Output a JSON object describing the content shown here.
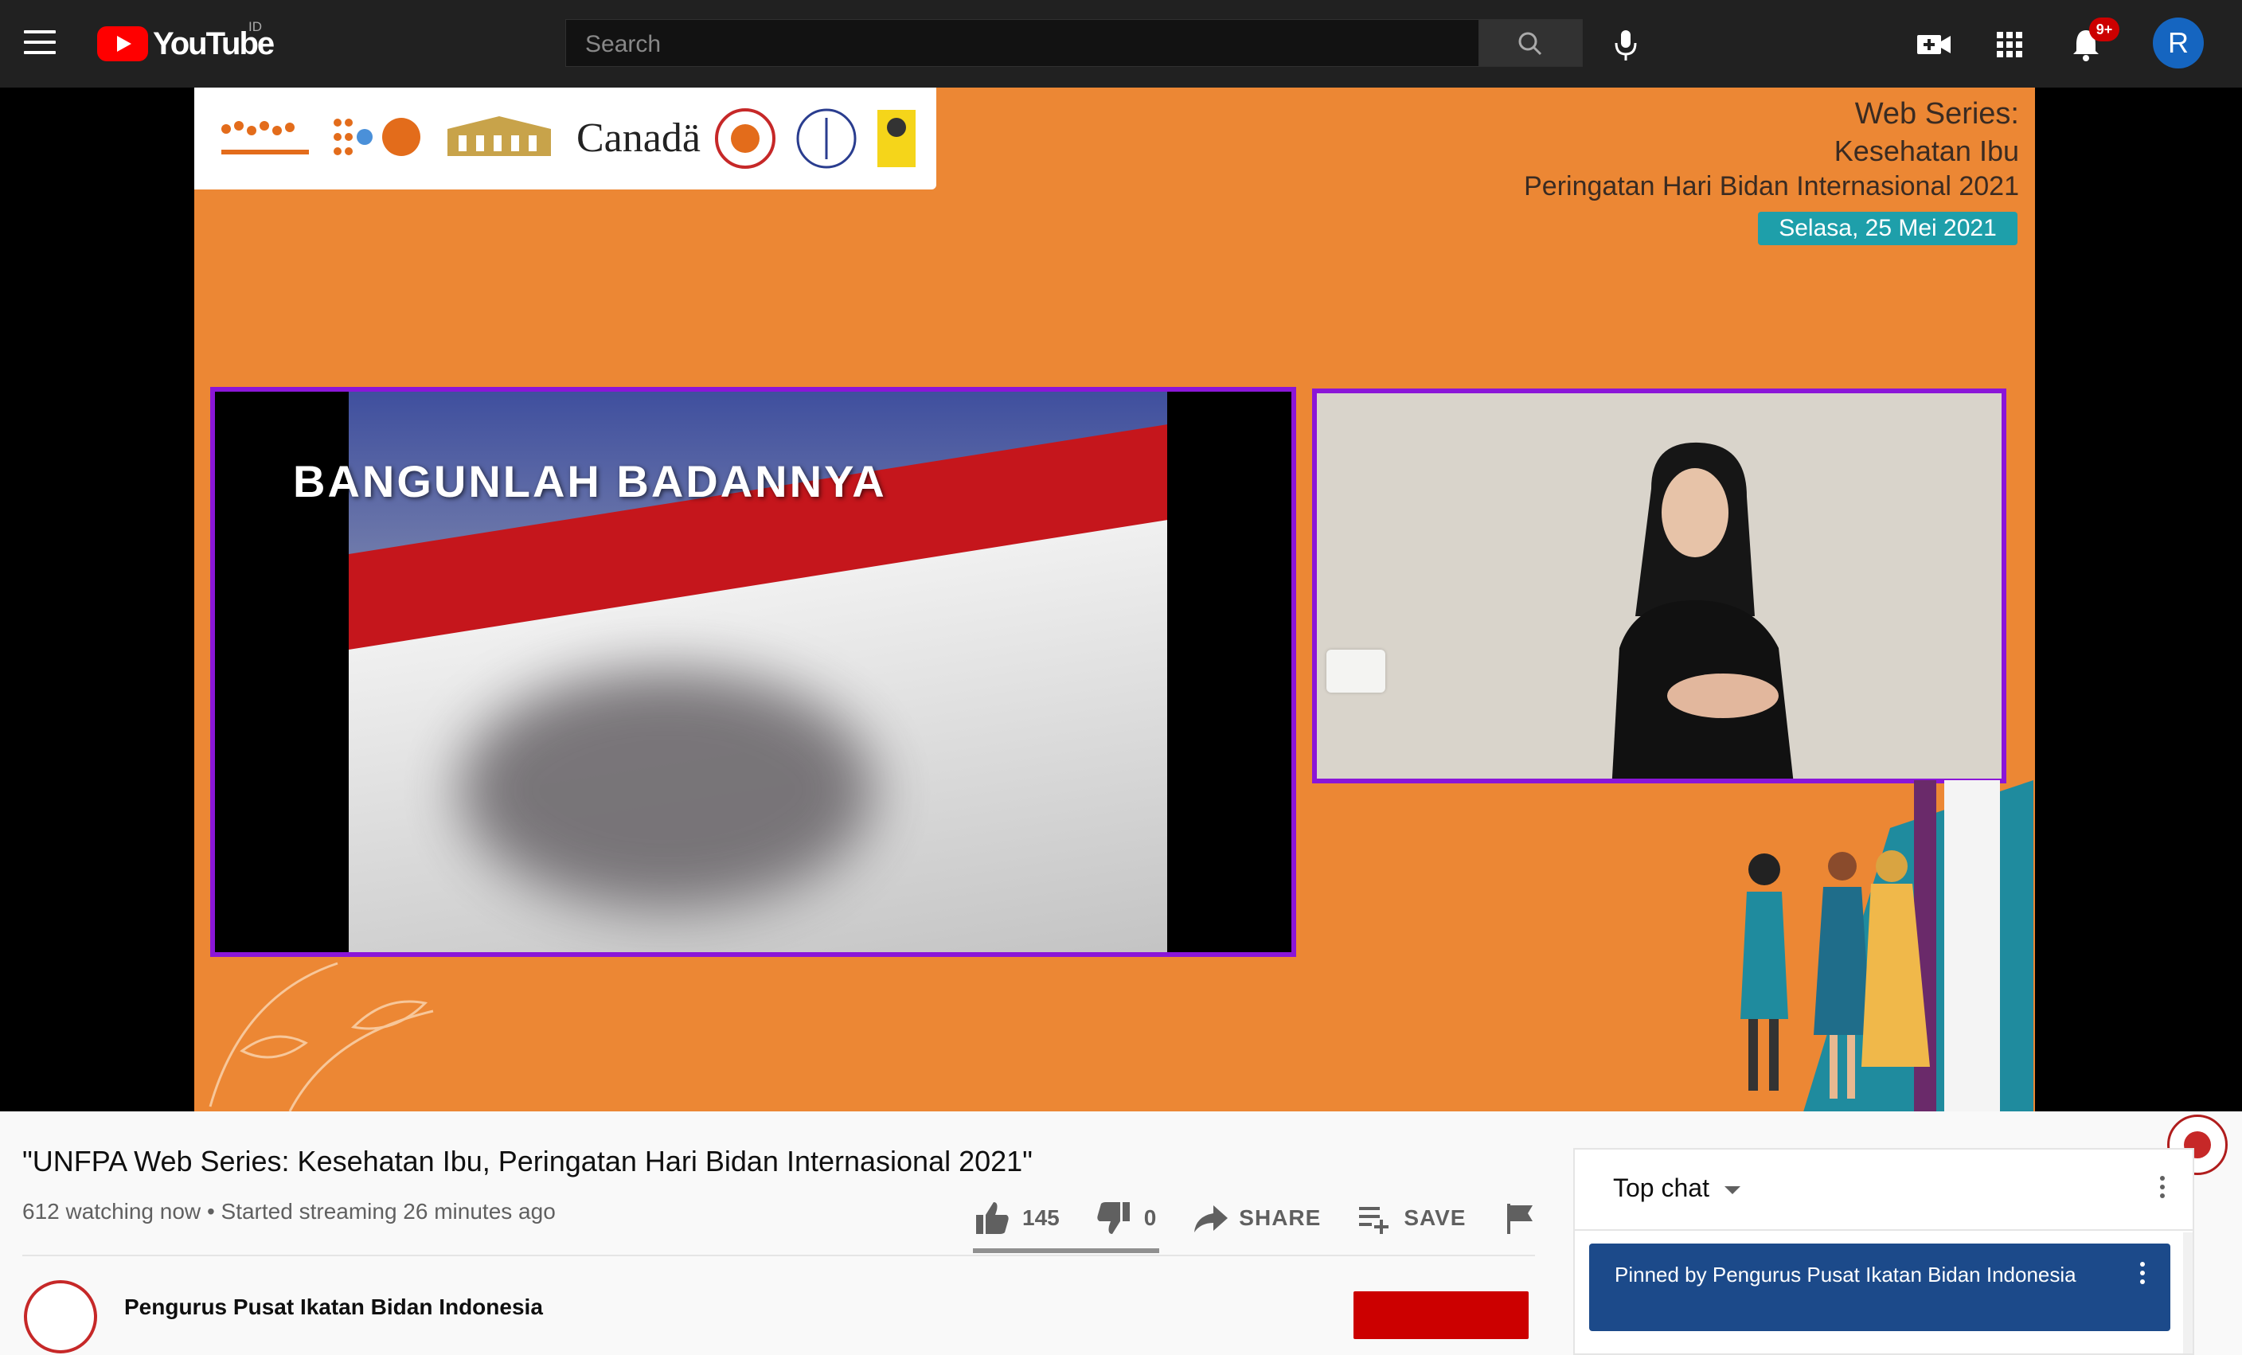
{
  "header": {
    "logo_text": "YouTube",
    "region": "ID",
    "search_placeholder": "Search",
    "notification_badge": "9+",
    "avatar_initial": "R"
  },
  "video": {
    "overlay": {
      "series_title": "Web Series:",
      "subtitle": "Kesehatan Ibu",
      "event": "Peringatan Hari Bidan Internasional 2021",
      "date": "Selasa, 25 Mei 2021",
      "caption": "BANGUNLAH BADANNYA",
      "sponsor_canada": "Canadä"
    },
    "title": "\"UNFPA Web Series: Kesehatan Ibu, Peringatan Hari Bidan Internasional 2021\"",
    "watching": "612 watching now",
    "started": "Started streaming 26 minutes ago",
    "likes": "145",
    "dislikes": "0",
    "share_label": "SHARE",
    "save_label": "SAVE"
  },
  "channel": {
    "name": "Pengurus Pusat Ikatan Bidan Indonesia"
  },
  "chat": {
    "mode": "Top chat",
    "pinned": "Pinned by Pengurus Pusat Ikatan Bidan Indonesia"
  },
  "colors": {
    "accent_red": "#ff0000",
    "video_bg": "#ec8734",
    "frame_purple": "#8b16d8",
    "pinned_blue": "#1c4a8a"
  }
}
